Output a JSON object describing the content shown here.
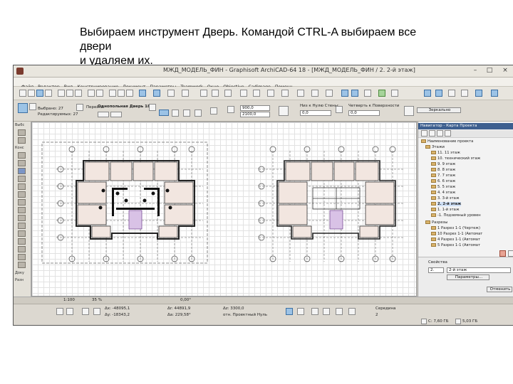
{
  "caption": {
    "line1": "Выбираем инструмент Дверь. Командой CTRL-A выбираем все",
    "line2": "двери",
    "line3": "и удаляем их."
  },
  "window": {
    "title": "МЖД_МОДЕЛЬ_ФИН - Graphisoft ArchiCAD-64 18 - [МЖД_МОДЕЛЬ_ФИН / 2. 2-й этаж]",
    "controls": [
      "–",
      "□",
      "×"
    ]
  },
  "menu": [
    "Файл",
    "Редактор",
    "Вид",
    "Конструирование",
    "Документ",
    "Параметры",
    "Teamwork",
    "Окно",
    "Objective",
    "Cadimage",
    "Помощь"
  ],
  "infobox": {
    "selected": "Выбрано: 27",
    "editable": "Редактируемых: 27",
    "go_to": "Перейти",
    "element_name": "Однопольная Дверь 18",
    "width": "900,0",
    "height": "2100,0",
    "reveal_label": "Низ к Нулю Стены:",
    "reveal_value": "0,0",
    "threshold_label": "Четверть к Поверхности",
    "threshold_value": "0,0",
    "mirror_label": "Зеркально"
  },
  "toolbox": {
    "top_label": "Выбс",
    "construct_label": "Конс",
    "doc_label": "Доку",
    "misc_label": "Разн"
  },
  "navigator": {
    "header": "Навигатор - Карта Проекта",
    "items": [
      {
        "label": "Наименование проекта",
        "level": 0
      },
      {
        "label": "Этажи",
        "level": 1
      },
      {
        "label": "11. 11 этаж",
        "level": 2
      },
      {
        "label": "10. технический этаж",
        "level": 2
      },
      {
        "label": "9. 9 этаж",
        "level": 2
      },
      {
        "label": "8. 8 этаж",
        "level": 2
      },
      {
        "label": "7. 7 этаж",
        "level": 2
      },
      {
        "label": "6. 6 этаж",
        "level": 2
      },
      {
        "label": "5. 5 этаж",
        "level": 2
      },
      {
        "label": "4. 4 этаж",
        "level": 2
      },
      {
        "label": "3. 3-й этаж",
        "level": 2
      },
      {
        "label": "2. 2-й этаж",
        "level": 2,
        "selected": true
      },
      {
        "label": "1. 1-й этаж",
        "level": 2
      },
      {
        "label": "-1. Подземный уровен",
        "level": 2
      },
      {
        "label": "Разрезы",
        "level": 1
      },
      {
        "label": "1 Разрез 1-1 (Чертеж)",
        "level": 2
      },
      {
        "label": "10 Разрез 1-1 (Автомат",
        "level": 2
      },
      {
        "label": "4 Разрез 1-1 (Автомат",
        "level": 2
      },
      {
        "label": "5 Разрез 1-1 (Автомат",
        "level": 2
      }
    ],
    "props_title": "Свойства",
    "props_num": "2.",
    "props_name": "2-й этаж",
    "params_button": "Параметры...",
    "cancel_button": "Отменить"
  },
  "statusbar": {
    "scale": "1:100",
    "zoom": "35 %",
    "angle": "0,00°",
    "dx": "Δx: -48095,1",
    "dy": "Δy: -18343,2",
    "dr": "Δr: 44891,9",
    "da": "Δa: 229,58°",
    "dz": "Δz: 3300,0",
    "ref": "отн. Проектный Нуль",
    "snap": "Середина",
    "snap_value": "2",
    "disk_c": "C: 7,60 ГБ",
    "disk_d": "5,03 ГБ"
  }
}
